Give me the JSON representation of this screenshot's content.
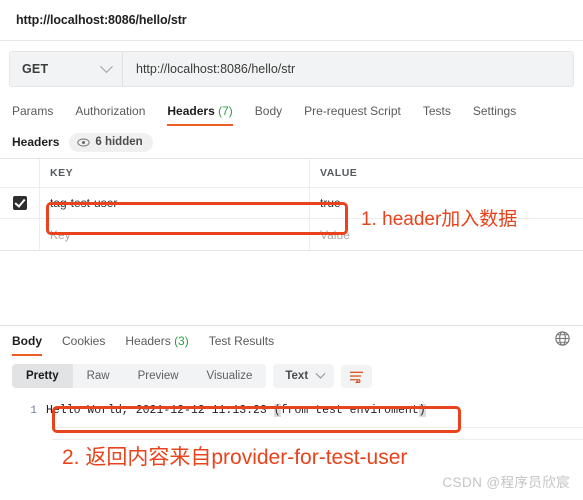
{
  "request": {
    "title": "http://localhost:8086/hello/str",
    "method": "GET",
    "url": "http://localhost:8086/hello/str",
    "tabs": [
      {
        "label": "Params",
        "active": false
      },
      {
        "label": "Authorization",
        "active": false
      },
      {
        "label": "Headers",
        "count": "(7)",
        "active": true
      },
      {
        "label": "Body",
        "active": false
      },
      {
        "label": "Pre-request Script",
        "active": false
      },
      {
        "label": "Tests",
        "active": false
      },
      {
        "label": "Settings",
        "active": false
      }
    ],
    "headers_section": {
      "label": "Headers",
      "hidden_badge": "6 hidden",
      "eye_icon": "eye-icon",
      "columns": {
        "key": "KEY",
        "value": "VALUE"
      },
      "rows": [
        {
          "checked": true,
          "key": "tag-test-user",
          "value": "true"
        }
      ],
      "empty_row": {
        "key_placeholder": "Key",
        "value_placeholder": "Value"
      }
    }
  },
  "response": {
    "tabs": [
      {
        "label": "Body",
        "active": true
      },
      {
        "label": "Cookies",
        "active": false
      },
      {
        "label": "Headers",
        "count": "(3)",
        "active": false
      },
      {
        "label": "Test Results",
        "active": false
      }
    ],
    "globe_icon": "globe-icon",
    "format_tabs": [
      {
        "label": "Pretty",
        "active": true
      },
      {
        "label": "Raw",
        "active": false
      },
      {
        "label": "Preview",
        "active": false
      },
      {
        "label": "Visualize",
        "active": false
      }
    ],
    "type_select": "Text",
    "wrap_icon": "word-wrap-icon",
    "body": {
      "line_number": "1",
      "text_before": "Hello World, 2021-12-12 11:13:23 ",
      "text_paren_open": "(",
      "text_inner": "from test enviroment",
      "text_paren_close": ")"
    }
  },
  "annotations": {
    "header_note": "1. header加入数据",
    "body_note": "2. 返回内容来自provider-for-test-user",
    "color": "#e8431c"
  },
  "watermark": "CSDN @程序员欣宸"
}
